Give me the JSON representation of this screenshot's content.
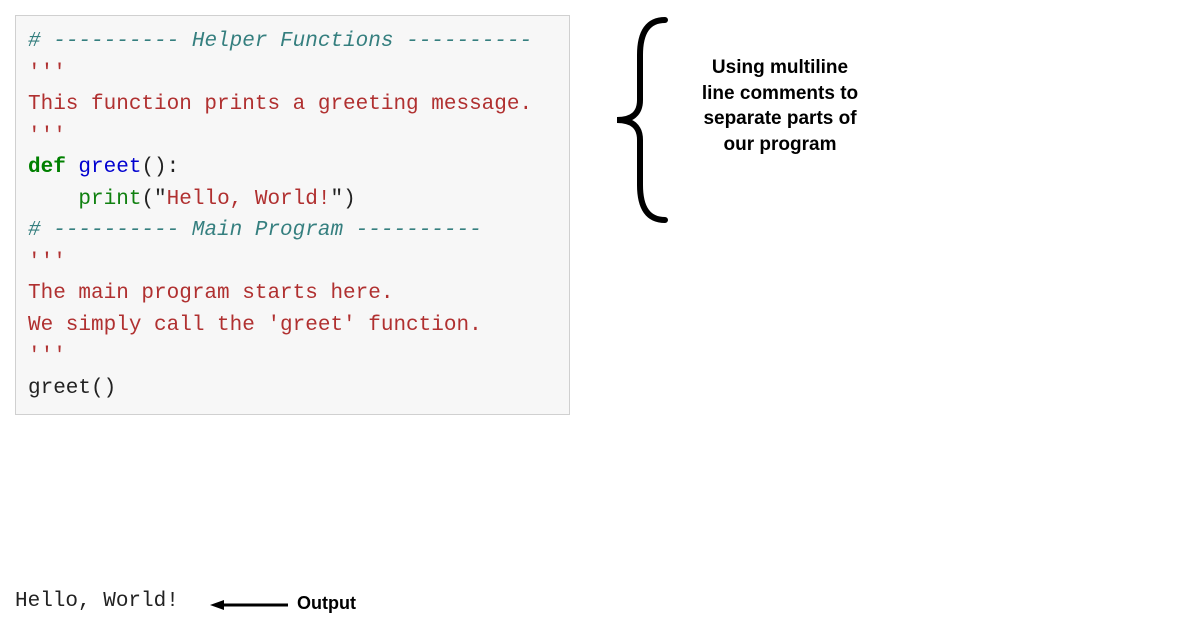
{
  "code": {
    "line1_hash": "# ",
    "line1_dashes1": "---------- ",
    "line1_title": "Helper Functions",
    "line1_dashes2": " ----------",
    "blank": "",
    "tripleq1": "'''",
    "doc1": "This function prints a greeting message.",
    "tripleq2": "'''",
    "def": "def ",
    "funcname": "greet",
    "parens_def": "():",
    "indent": "    ",
    "printcall": "print",
    "str_open": "(\"",
    "str_body": "Hello, World!",
    "str_close": "\")",
    "line2_hash": "# ",
    "line2_dashes1": "---------- ",
    "line2_title": "Main Program",
    "line2_dashes2": " ----------",
    "tripleq3": "'''",
    "doc2a": "The main program starts here.",
    "doc2b": "We simply call the 'greet' function.",
    "tripleq4": "'''",
    "call": "greet",
    "call_parens": "()"
  },
  "output": {
    "text": "Hello, World!"
  },
  "annotations": {
    "right": "Using multiline line comments to separate parts of our program",
    "output_label": "Output"
  }
}
